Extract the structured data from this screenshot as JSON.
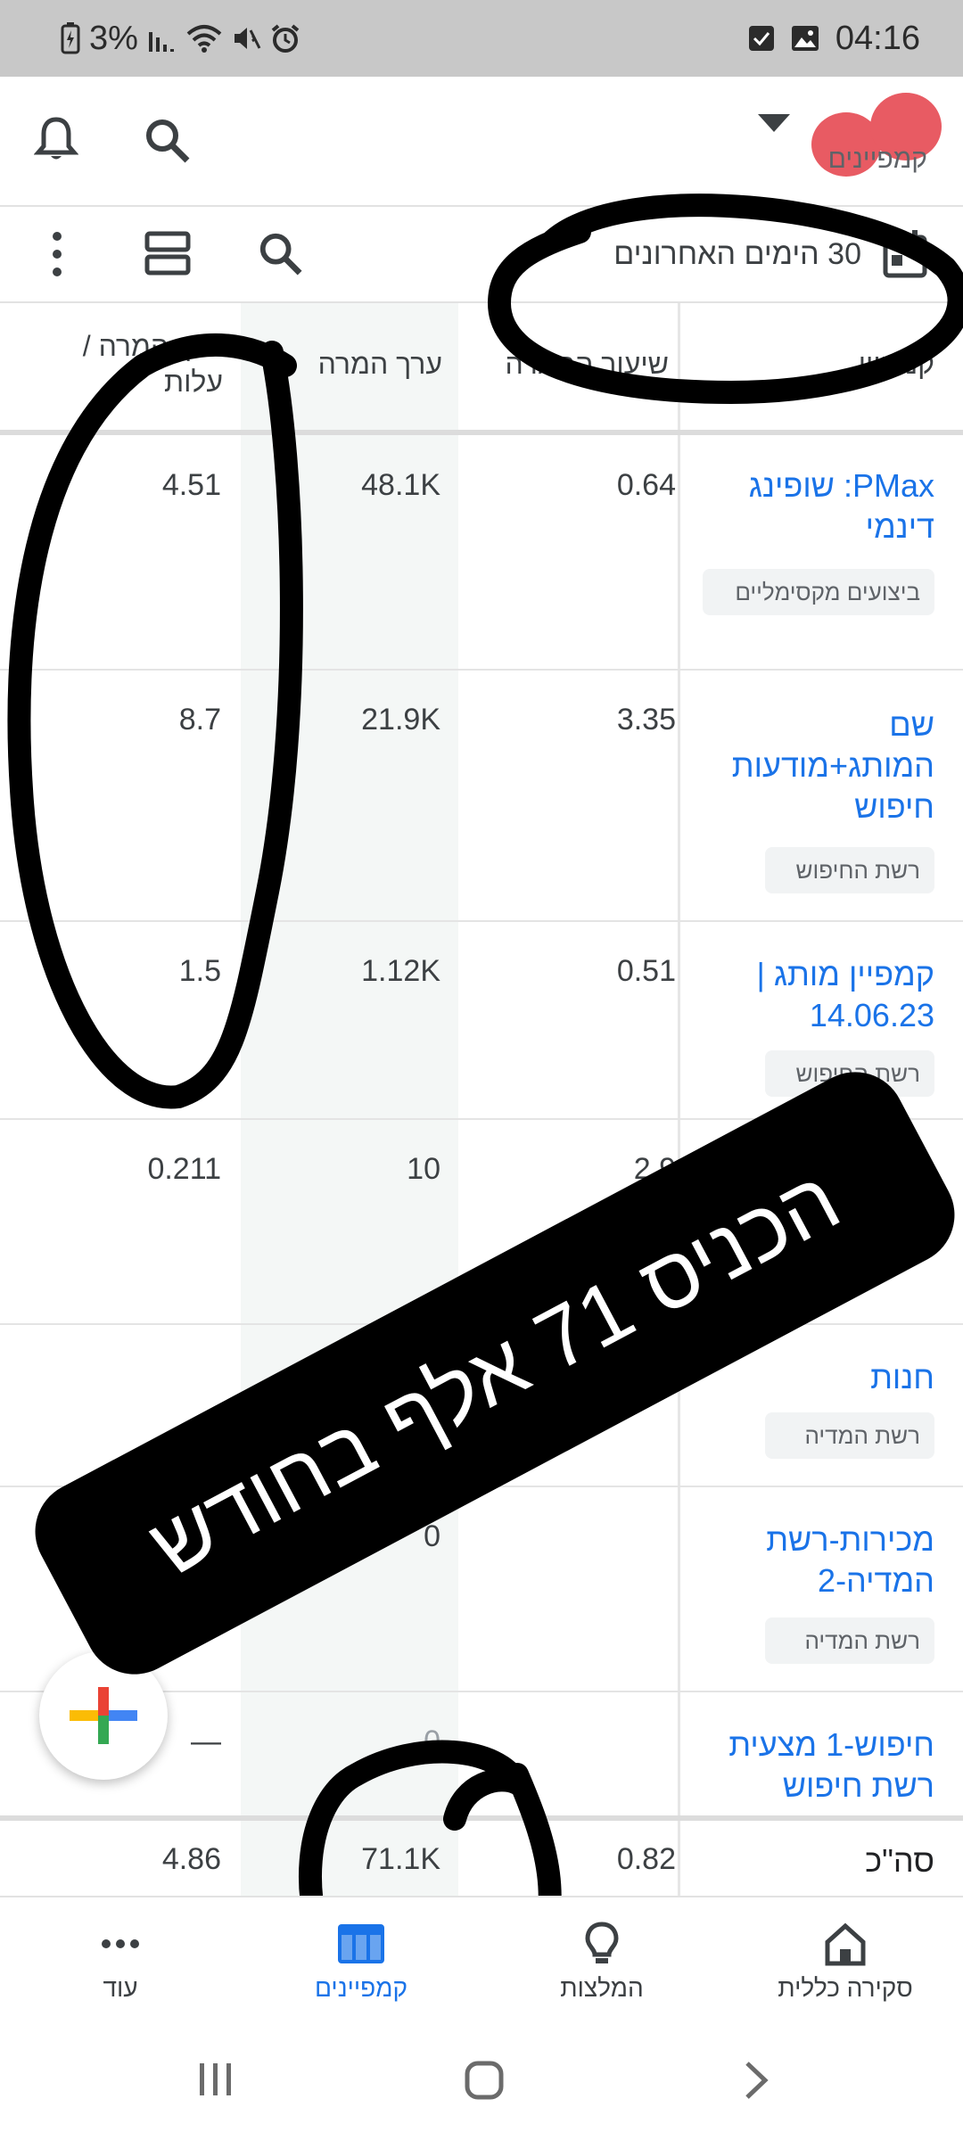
{
  "status": {
    "battery": "3%",
    "time": "04:16"
  },
  "header": {
    "subtitle": "קמפיינים"
  },
  "toolbar": {
    "date_range": "30 הימים האחרונים"
  },
  "table": {
    "headers": [
      "קמפיין",
      "שיעור ההמרה",
      "ערך המרה",
      "ערך המרה / עלות"
    ],
    "rows": [
      {
        "name": "PMax: שופינג דינמי",
        "type": "ביצועים מקסימליים",
        "rate": "0.64",
        "value": "48.1K",
        "ratio": "4.51"
      },
      {
        "name": "שם המותג+מודעות חיפוש",
        "type": "רשת החיפוש",
        "rate": "3.35",
        "value": "21.9K",
        "ratio": "8.7"
      },
      {
        "name": "קמפיין מותג | 14.06.23",
        "type": "רשת החיפוש",
        "rate": "0.51",
        "value": "1.12K",
        "ratio": "1.5"
      },
      {
        "name": "",
        "type": "",
        "rate": "2.9",
        "value": "10",
        "ratio": "0.211"
      },
      {
        "name": "חנות",
        "type": "רשת המדיה",
        "rate": "",
        "value": "",
        "ratio": ""
      },
      {
        "name": "מכירות-רשת המדיה-2",
        "type": "רשת המדיה",
        "rate": "-",
        "value": "0",
        "ratio": ""
      },
      {
        "name": "חיפוש-1 מצעית רשת חיפוש",
        "type": "",
        "rate": "-",
        "value": "0",
        "ratio": "—"
      }
    ],
    "total": {
      "label": "סה\"כ",
      "rate": "0.82",
      "value": "71.1K",
      "ratio": "4.86"
    }
  },
  "overlay": {
    "text": "הכניס 71 אלף בחודש"
  },
  "bottom_nav": {
    "items": [
      "סקירה כללית",
      "המלצות",
      "קמפיינים",
      "עוד"
    ]
  },
  "colors": {
    "link": "#1a73e8",
    "active": "#1a73e8",
    "status_bar": "#c8c8c8"
  }
}
